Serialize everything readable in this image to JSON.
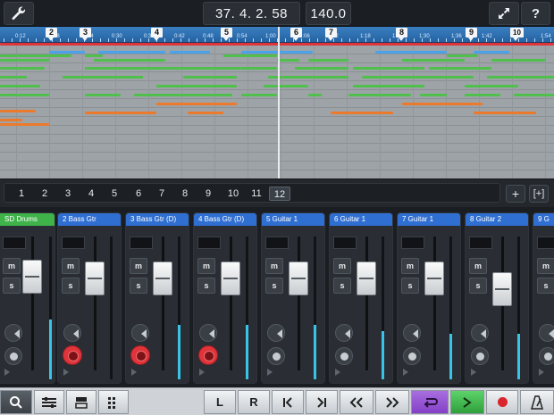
{
  "toolbar": {
    "position": "37. 4. 2. 58",
    "tempo": "140.0"
  },
  "ruler": {
    "times": [
      "0:12",
      "0:18",
      "0:24",
      "0:30",
      "0:36",
      "0:42",
      "0:48",
      "0:54",
      "1:00",
      "1:06",
      "1:12",
      "1:18",
      "1:24",
      "1:30",
      "1:36",
      "1:42",
      "1:48",
      "1:54"
    ],
    "markers": [
      "2",
      "3",
      "4",
      "5",
      "6",
      "7",
      "8",
      "9",
      "10"
    ]
  },
  "scenes": {
    "labels": [
      "1",
      "2",
      "3",
      "4",
      "5",
      "6",
      "7",
      "8",
      "9",
      "10",
      "11",
      "12"
    ],
    "active": "12",
    "add_label": "+",
    "add_track_label": "[+]"
  },
  "mixer": {
    "channels": [
      {
        "name": "SD Drums",
        "color": "#3fb34a",
        "mute": "m",
        "solo": "s",
        "level": 0.42,
        "record": false
      },
      {
        "name": "2  Bass Gtr",
        "color": "#2f6fd1",
        "mute": "m",
        "solo": "s",
        "level": 0.0,
        "record": true
      },
      {
        "name": "3  Bass Gtr (D)",
        "color": "#2f6fd1",
        "mute": "m",
        "solo": "s",
        "level": 0.38,
        "record": true
      },
      {
        "name": "4  Bass Gtr (D)",
        "color": "#2f6fd1",
        "mute": "m",
        "solo": "s",
        "level": 0.38,
        "record": true
      },
      {
        "name": "5  Guitar 1",
        "color": "#2f6fd1",
        "mute": "m",
        "solo": "s",
        "level": 0.38,
        "record": false
      },
      {
        "name": "6  Guitar 1",
        "color": "#2f6fd1",
        "mute": "m",
        "solo": "s",
        "level": 0.34,
        "record": false
      },
      {
        "name": "7  Guitar 1",
        "color": "#2f6fd1",
        "mute": "m",
        "solo": "s",
        "level": 0.32,
        "record": false
      },
      {
        "name": "8  Guitar 2",
        "color": "#2f6fd1",
        "mute": "m",
        "solo": "s",
        "level": 0.32,
        "record": false
      },
      {
        "name": "9  G",
        "color": "#2f6fd1",
        "mute": "m",
        "solo": "s",
        "level": 0.36,
        "record": false
      }
    ]
  },
  "transport": {
    "left_locator": "L",
    "right_locator": "R"
  },
  "colors": {
    "green_track": "#3fb34a",
    "blue_track": "#2f6fd1",
    "loop_active": "#9b57d6",
    "play_active": "#37b44a",
    "record": "#e0343b",
    "level_meter": "#37c4e6"
  }
}
